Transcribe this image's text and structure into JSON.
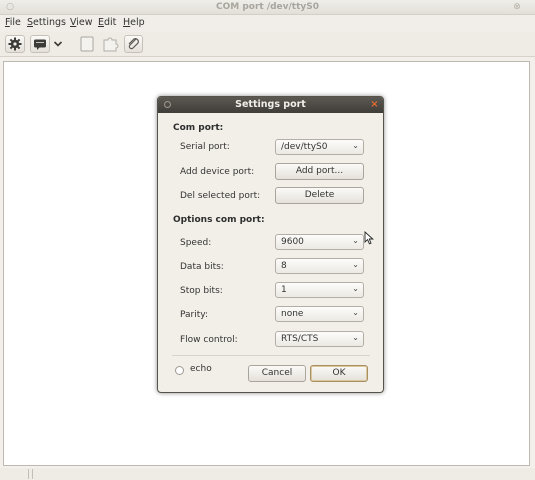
{
  "window": {
    "title": "COM port /dev/ttyS0"
  },
  "menubar": {
    "items": [
      {
        "label": "File",
        "key": "F",
        "rest": "ile"
      },
      {
        "label": "Settings",
        "key": "S",
        "rest": "ettings"
      },
      {
        "label": "View",
        "key": "V",
        "rest": "iew"
      },
      {
        "label": "Edit",
        "key": "E",
        "rest": "dit"
      },
      {
        "label": "Help",
        "key": "H",
        "rest": "elp"
      }
    ]
  },
  "toolbar": {
    "icons": [
      "gear-icon",
      "chat-icon",
      "dropdown-arrow-icon",
      "blank-document-icon",
      "puzzle-icon",
      "attachment-icon"
    ]
  },
  "dialog": {
    "title": "Settings port",
    "com_section": "Com port:",
    "serial_port_label": "Serial port:",
    "serial_port_value": "/dev/ttyS0",
    "add_device_label": "Add device port:",
    "add_port_button": "Add port...",
    "del_selected_label": "Del selected port:",
    "delete_button": "Delete",
    "options_section": "Options com port:",
    "speed_label": "Speed:",
    "speed_value": "9600",
    "data_bits_label": "Data bits:",
    "data_bits_value": "8",
    "stop_bits_label": "Stop bits:",
    "stop_bits_value": "1",
    "parity_label": "Parity:",
    "parity_value": "none",
    "flow_control_label": "Flow control:",
    "flow_control_value": "RTS/CTS",
    "echo_label": "echo",
    "echo_checked": false,
    "cancel_button": "Cancel",
    "ok_button": "OK"
  },
  "colors": {
    "dialog_titlebar": "#4a4742",
    "close_accent": "#e36b2c",
    "workarea": "#ffffff"
  }
}
